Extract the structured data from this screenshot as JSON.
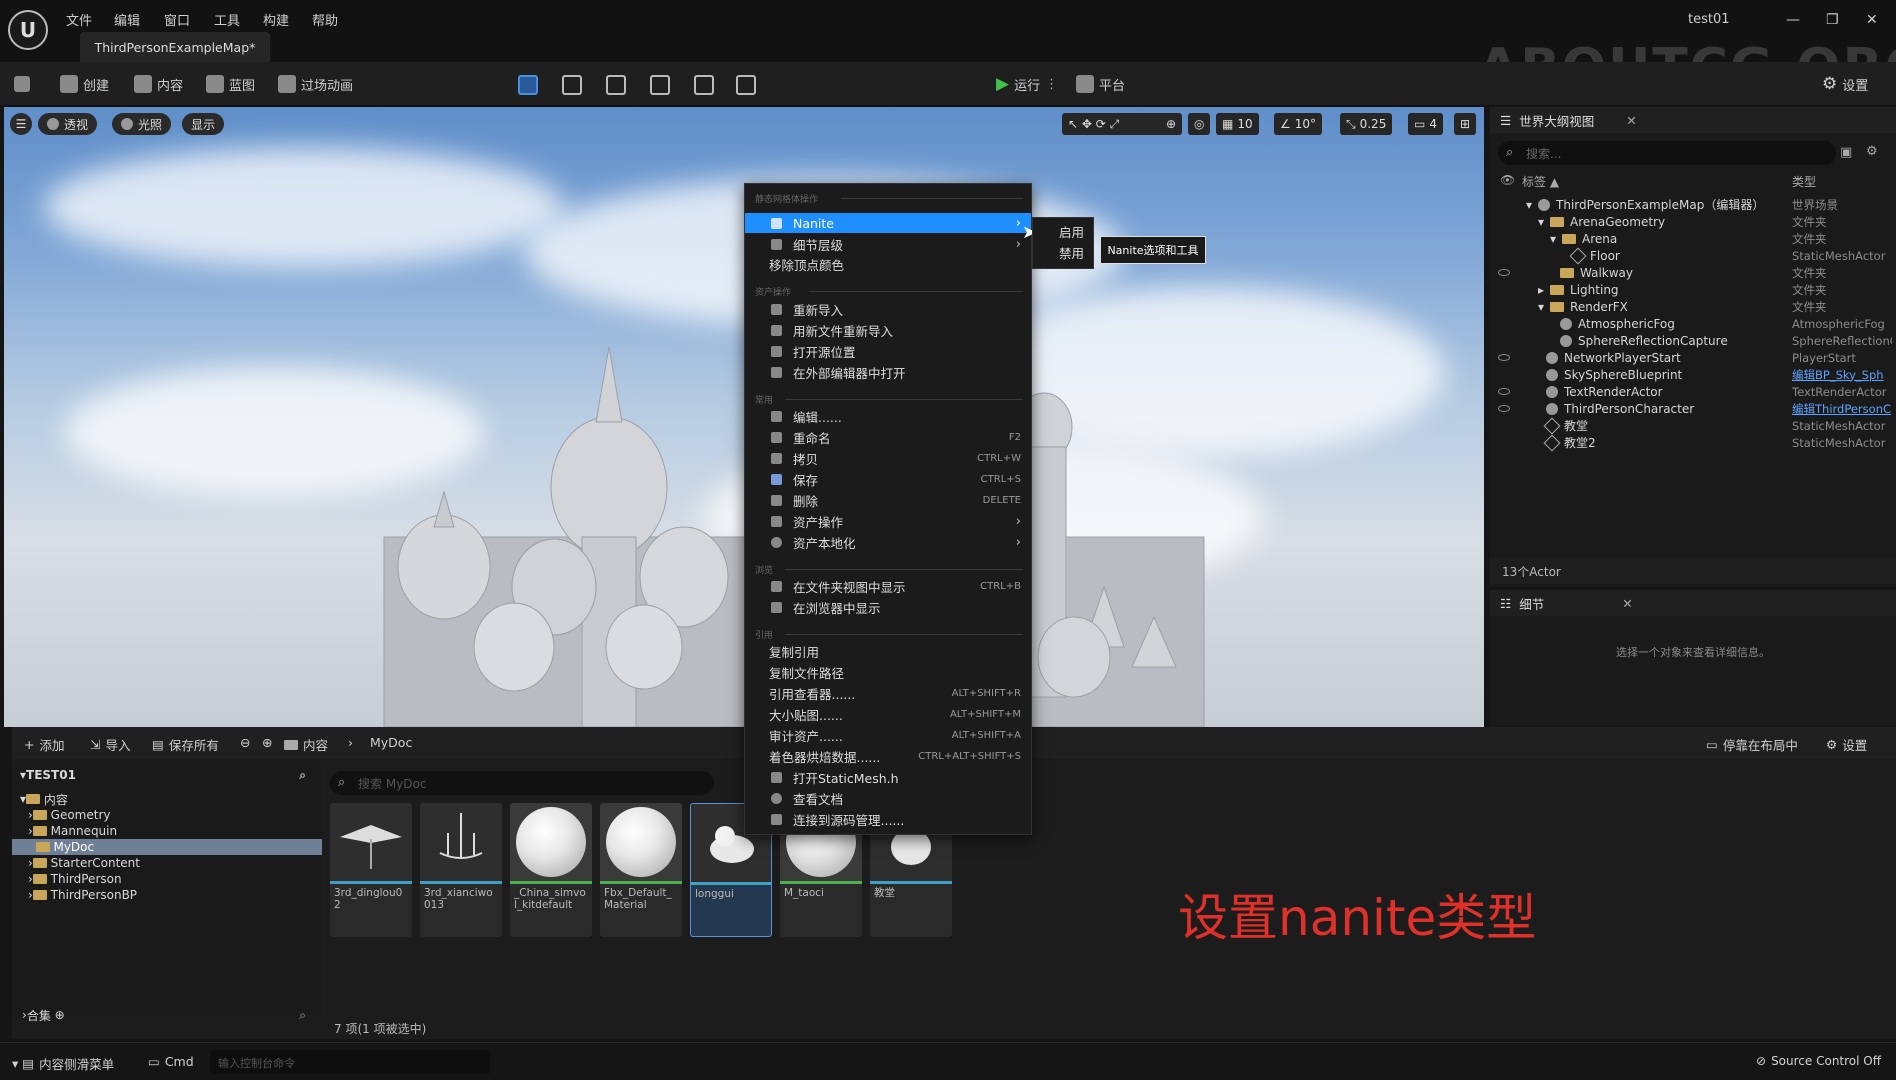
{
  "menubar": {
    "items": [
      "文件",
      "编辑",
      "窗口",
      "工具",
      "构建",
      "帮助"
    ],
    "project_name": "test01",
    "tab_title": "ThirdPersonExampleMap*",
    "watermark": "ABOUTCG.ORG"
  },
  "toolbar": {
    "create": "创建",
    "content": "内容",
    "blueprint": "蓝图",
    "cinematics": "过场动画",
    "play": "运行",
    "platform": "平台",
    "settings": "设置"
  },
  "viewport": {
    "perspective": "透视",
    "lighting": "光照",
    "show": "显示",
    "grid_snap": "10",
    "rotation_snap": "10°",
    "scale_snap": "0.25",
    "camera_speed": "4"
  },
  "outliner": {
    "title": "世界大纲视图",
    "search_placeholder": "搜索...",
    "col_label": "标签 ▲",
    "col_type": "类型",
    "rows": [
      {
        "name": "ThirdPersonExampleMap（编辑器）",
        "type": "世界场景"
      },
      {
        "name": "ArenaGeometry",
        "type": "文件夹"
      },
      {
        "name": "Arena",
        "type": "文件夹"
      },
      {
        "name": "Floor",
        "type": "StaticMeshActor"
      },
      {
        "name": "Walkway",
        "type": "文件夹"
      },
      {
        "name": "Lighting",
        "type": "文件夹"
      },
      {
        "name": "RenderFX",
        "type": "文件夹"
      },
      {
        "name": "AtmosphericFog",
        "type": "AtmosphericFog"
      },
      {
        "name": "SphereReflectionCapture",
        "type": "SphereReflectionC"
      },
      {
        "name": "NetworkPlayerStart",
        "type": "PlayerStart"
      },
      {
        "name": "SkySphereBlueprint",
        "type": "编辑BP_Sky_Sph"
      },
      {
        "name": "TextRenderActor",
        "type": "TextRenderActor"
      },
      {
        "name": "ThirdPersonCharacter",
        "type": "编辑ThirdPersonC"
      },
      {
        "name": "教堂",
        "type": "StaticMeshActor"
      },
      {
        "name": "教堂2",
        "type": "StaticMeshActor"
      }
    ],
    "actor_count": "13个Actor"
  },
  "details": {
    "title": "细节",
    "empty_text": "选择一个对象来查看详细信息。"
  },
  "context_menu": {
    "sections": [
      "静态网格体操作",
      "资产操作",
      "常用",
      "浏览",
      "引用"
    ],
    "items": [
      {
        "label": "Nanite",
        "shortcut": "",
        "submenu": true,
        "highlight": true
      },
      {
        "label": "细节层级",
        "shortcut": "",
        "submenu": true
      },
      {
        "label": "移除顶点颜色",
        "shortcut": ""
      },
      {
        "label": "重新导入",
        "shortcut": ""
      },
      {
        "label": "用新文件重新导入",
        "shortcut": ""
      },
      {
        "label": "打开源位置",
        "shortcut": ""
      },
      {
        "label": "在外部编辑器中打开",
        "shortcut": ""
      },
      {
        "label": "编辑......",
        "shortcut": ""
      },
      {
        "label": "重命名",
        "shortcut": "F2"
      },
      {
        "label": "拷贝",
        "shortcut": "CTRL+W"
      },
      {
        "label": "保存",
        "shortcut": "CTRL+S"
      },
      {
        "label": "删除",
        "shortcut": "DELETE"
      },
      {
        "label": "资产操作",
        "shortcut": "",
        "submenu": true
      },
      {
        "label": "资产本地化",
        "shortcut": "",
        "submenu": true
      },
      {
        "label": "在文件夹视图中显示",
        "shortcut": "CTRL+B"
      },
      {
        "label": "在浏览器中显示",
        "shortcut": ""
      },
      {
        "label": "复制引用",
        "shortcut": ""
      },
      {
        "label": "复制文件路径",
        "shortcut": ""
      },
      {
        "label": "引用查看器......",
        "shortcut": "ALT+SHIFT+R"
      },
      {
        "label": "大小贴图......",
        "shortcut": "ALT+SHIFT+M"
      },
      {
        "label": "审计资产......",
        "shortcut": "ALT+SHIFT+A"
      },
      {
        "label": "着色器烘焙数据......",
        "shortcut": "CTRL+ALT+SHIFT+S"
      },
      {
        "label": "打开StaticMesh.h",
        "shortcut": ""
      },
      {
        "label": "查看文档",
        "shortcut": ""
      },
      {
        "label": "连接到源码管理......",
        "shortcut": ""
      }
    ],
    "submenu": [
      "启用",
      "禁用"
    ],
    "tooltip": "Nanite选项和工具"
  },
  "content_browser": {
    "add": "添加",
    "import": "导入",
    "save_all": "保存所有",
    "path_root": "内容",
    "path_current": "MyDoc",
    "dock": "停靠在布局中",
    "settings": "设置",
    "project": "TEST01",
    "tree": [
      "内容",
      "Geometry",
      "Mannequin",
      "MyDoc",
      "StarterContent",
      "ThirdPerson",
      "ThirdPersonBP"
    ],
    "collections": "合集",
    "search_placeholder": "搜索 MyDoc",
    "assets": [
      "3rd_dinglou02",
      "3rd_xianciwo013",
      "_China_simvol_kitdefault",
      "Fbx_Default_Material",
      "longgui",
      "M_taoci",
      "教堂"
    ],
    "count": "7 项(1 项被选中)"
  },
  "status": {
    "drawer": "内容侧滑菜单",
    "cmd": "Cmd",
    "console_placeholder": "输入控制台命令",
    "source_control": "Source Control Off"
  },
  "caption": "设置nanite类型"
}
